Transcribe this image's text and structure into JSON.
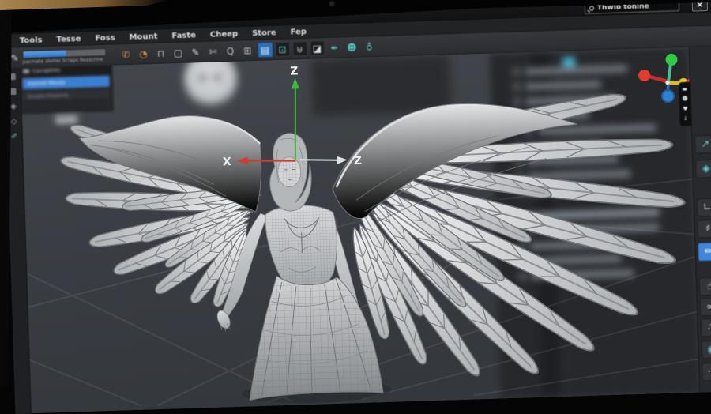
{
  "window": {
    "search_text": "Thwio tonine",
    "close_label": "×"
  },
  "menu": {
    "items": [
      "Tools",
      "Tesse",
      "Foss",
      "Mount",
      "Faste",
      "Cheep",
      "Store",
      "Fep"
    ]
  },
  "toolbar": {
    "pen_glyph": "✎",
    "caption": "pacmate alorter Scraps Reascrine",
    "icons": [
      {
        "name": "grab-tool-icon",
        "glyph": "✆"
      },
      {
        "name": "rotate-tool-icon",
        "glyph": "◔"
      },
      {
        "name": "lock-tool-icon",
        "glyph": "⊓"
      },
      {
        "name": "frame-tool-icon",
        "glyph": "▢"
      },
      {
        "name": "pen-tool-icon",
        "glyph": "✎"
      },
      {
        "name": "cut-tool-icon",
        "glyph": "✄"
      },
      {
        "name": "zoom-tool-icon",
        "glyph": "Q"
      },
      {
        "name": "duplicate-icon",
        "glyph": "⊞"
      },
      {
        "name": "folder-icon",
        "glyph": "▤"
      },
      {
        "name": "monitor-icon",
        "glyph": "⊡"
      },
      {
        "name": "trash-icon",
        "glyph": "⊎"
      },
      {
        "name": "image-icon",
        "glyph": "◪"
      },
      {
        "name": "brush-icon",
        "glyph": "✒"
      },
      {
        "name": "user-icon",
        "glyph": "☻"
      },
      {
        "name": "globe-icon",
        "glyph": "♁"
      }
    ]
  },
  "left_dock": {
    "icons": [
      {
        "name": "grid-icon",
        "glyph": "▦"
      },
      {
        "name": "layers-icon",
        "glyph": "▩"
      },
      {
        "name": "gem-icon",
        "glyph": "◈"
      },
      {
        "name": "diamond-icon",
        "glyph": "◇"
      },
      {
        "name": "pen-icon",
        "glyph": "✐"
      }
    ]
  },
  "left_panel": {
    "header": "Cacoptres",
    "selected_row": "Asored Moute",
    "row2": "Scoate Fesoone"
  },
  "viewport": {
    "axis_up_label": "Z",
    "axis_left_label": "X",
    "axis_right_label": "Z",
    "axis_colors": {
      "up": "#3cb83c",
      "left": "#d23c30",
      "right": "#e4e6e8"
    },
    "gizmo_colors": {
      "x": "#e03c30",
      "y": "#2fca46",
      "z": "#2f7fd4",
      "w": "#e8c426"
    }
  },
  "right_dock": {
    "pill_icons": [
      {
        "name": "comment-icon",
        "glyph": "▬"
      },
      {
        "name": "user-icon",
        "glyph": "☻"
      },
      {
        "name": "heart-icon",
        "glyph": "♥"
      },
      {
        "name": "download-icon",
        "glyph": "↓"
      }
    ],
    "buttons": [
      {
        "name": "redirect-tool",
        "glyph": "↗",
        "active": false
      },
      {
        "name": "gem-tool",
        "glyph": "◈",
        "active": false
      },
      {
        "name": "corner-tool",
        "glyph": "∟",
        "active": false
      },
      {
        "name": "hash-tool",
        "glyph": "♯",
        "active": false
      },
      {
        "name": "brush-tool",
        "glyph": "✏",
        "active": true
      },
      {
        "name": "hand-tool",
        "glyph": "☝",
        "active": false
      },
      {
        "name": "link-tool",
        "glyph": "∞",
        "active": false
      },
      {
        "name": "dots-tool",
        "glyph": "∴",
        "active": false
      },
      {
        "name": "sphere-tool",
        "glyph": "◉",
        "active": false
      },
      {
        "name": "more-tool",
        "glyph": "⋯",
        "active": false
      }
    ]
  }
}
